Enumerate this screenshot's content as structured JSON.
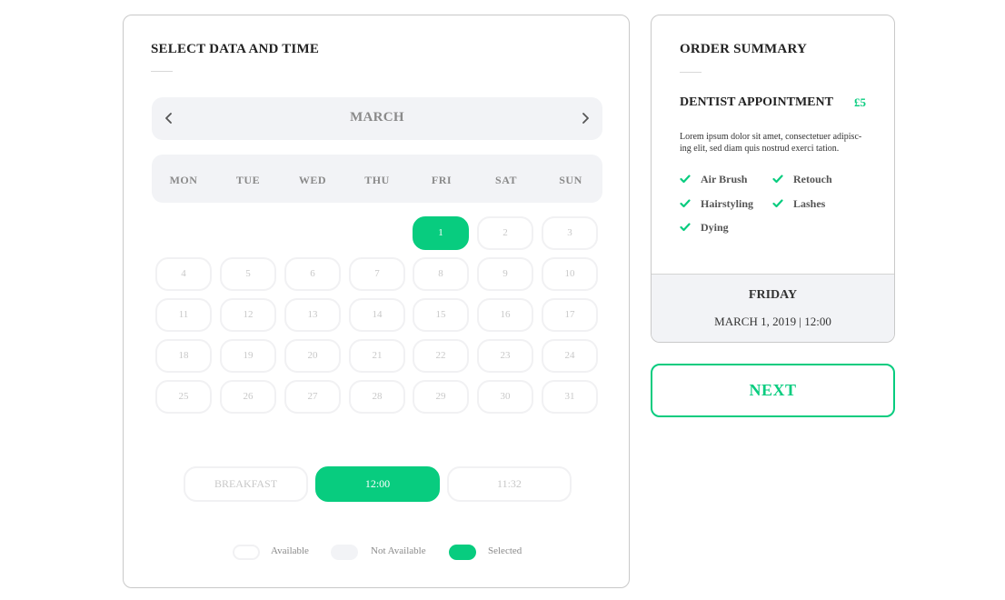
{
  "calendar": {
    "title": "SELECT DATA AND TIME",
    "month": "MARCH",
    "prev_icon": "chevron-left-icon",
    "next_icon": "chevron-right-icon",
    "weekdays": [
      "MON",
      "TUE",
      "WED",
      "THU",
      "FRI",
      "SAT",
      "SUN"
    ],
    "first_weekday_index": 4,
    "days_in_month": 31,
    "selected_day": 1
  },
  "time_slots": [
    {
      "label": "BREAKFAST",
      "selected": false
    },
    {
      "label": "12:00",
      "selected": true
    },
    {
      "label": "11:32",
      "selected": false
    }
  ],
  "legend": {
    "available": "Available",
    "not_available": "Not Available",
    "selected": "Selected"
  },
  "summary": {
    "title": "ORDER SUMMARY",
    "service": "DENTIST APPOINTMENT",
    "price": "£5",
    "description": "Lorem ipsum dolor sit amet, consectetuer adipisc-ing elit, sed diam quis nostrud exerci tation.",
    "features": [
      "Air Brush",
      "Retouch",
      "Hairstyling",
      "Lashes",
      "Dying"
    ],
    "day": "FRIDAY",
    "datetime": "MARCH 1, 2019 | 12:00"
  },
  "next_button": "NEXT",
  "colors": {
    "accent": "#08cc7f",
    "panel": "#f2f3f6",
    "muted_text": "#8a8a8a"
  }
}
